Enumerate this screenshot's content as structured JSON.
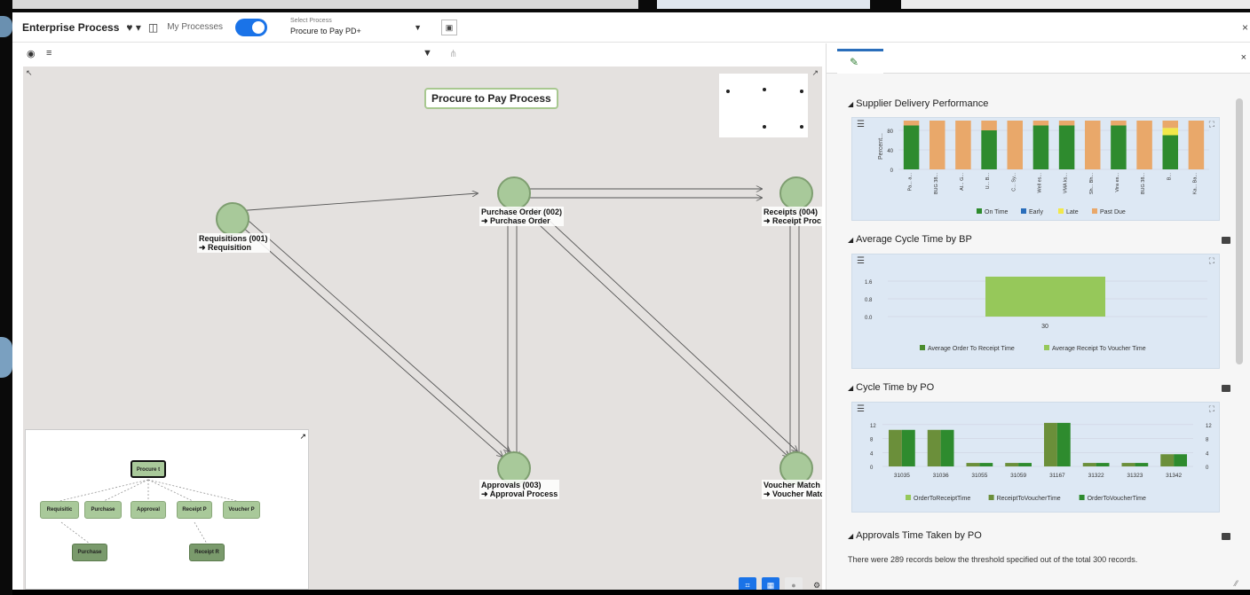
{
  "toolbar": {
    "app_title": "Enterprise Process",
    "my_processes_label": "My Processes",
    "select_process_label": "Select Process",
    "select_process_value": "Procure to Pay PD+"
  },
  "diagram": {
    "title": "Procure to Pay Process",
    "nodes": [
      {
        "id": "requisitions",
        "line1": "Requisitions (001)",
        "line2": "➜ Requisition"
      },
      {
        "id": "purchase_order",
        "line1": "Purchase Order (002)",
        "line2": "➜ Purchase Order"
      },
      {
        "id": "receipts",
        "line1": "Receipts (004)",
        "line2": "➜ Receipt Proc"
      },
      {
        "id": "approvals",
        "line1": "Approvals (003)",
        "line2": "➜ Approval Process"
      },
      {
        "id": "voucher_match",
        "line1": "Voucher Match (",
        "line2": "➜ Voucher Matc"
      }
    ]
  },
  "minimap": {
    "root": "Procure t",
    "children": [
      "Requisitic",
      "Purchase",
      "Approval",
      "Receipt P",
      "Voucher P"
    ],
    "grandchildren": [
      "Purchase",
      "Receipt R"
    ]
  },
  "panel": {
    "sections": [
      {
        "title": "Supplier Delivery Performance"
      },
      {
        "title": "Average Cycle Time by BP"
      },
      {
        "title": "Cycle Time by PO"
      },
      {
        "title": "Approvals Time Taken by PO"
      }
    ],
    "approvals_note": "There were 289 records below the threshold specified out of the total 300 records."
  },
  "colors": {
    "on_time": "#2e8b2e",
    "early": "#2a6ebb",
    "late": "#f2e84a",
    "past_due": "#e9a86a",
    "avg_order_to_receipt": "#4b8c2e",
    "avg_receipt_to_voucher": "#96c85a",
    "accent": "#1a73e8"
  },
  "chart_data": [
    {
      "type": "bar",
      "title": "Supplier Delivery Performance",
      "ylabel": "Percent...",
      "ylim": [
        0,
        100
      ],
      "yticks": [
        0,
        40,
        80
      ],
      "categories": [
        "Pa... a...",
        "BUG 38...",
        "Al... G...",
        "U... B...",
        "C... Sy...",
        "Well es...",
        "VMA ks...",
        "Sh... Bh...",
        "Vira es...",
        "BUG 38...",
        "B...",
        "Ka... Ba..."
      ],
      "series": [
        {
          "name": "On Time",
          "values": [
            90,
            0,
            0,
            80,
            0,
            90,
            90,
            0,
            90,
            0,
            70,
            0
          ]
        },
        {
          "name": "Early",
          "values": [
            0,
            0,
            0,
            0,
            0,
            0,
            0,
            0,
            0,
            0,
            0,
            0
          ]
        },
        {
          "name": "Late",
          "values": [
            0,
            0,
            0,
            0,
            0,
            0,
            0,
            0,
            0,
            0,
            15,
            0
          ]
        },
        {
          "name": "Past Due",
          "values": [
            10,
            100,
            100,
            20,
            100,
            10,
            10,
            100,
            10,
            100,
            15,
            100
          ]
        }
      ],
      "stacked": true,
      "legend": "bottom"
    },
    {
      "type": "bar",
      "title": "Average Cycle Time by BP",
      "ylim": [
        0,
        2
      ],
      "yticks": [
        "1.6",
        "0.8",
        "0.0"
      ],
      "categories": [
        "30"
      ],
      "series": [
        {
          "name": "Average Order To Receipt Time",
          "values": [
            0
          ]
        },
        {
          "name": "Average Receipt To Voucher Time",
          "values": [
            1.8
          ]
        }
      ],
      "legend": "bottom"
    },
    {
      "type": "bar",
      "title": "Cycle Time by PO",
      "ylim": [
        0,
        14
      ],
      "yticks": [
        0,
        4,
        8,
        12
      ],
      "categories": [
        "31035",
        "31036",
        "31055",
        "31059",
        "31167",
        "31322",
        "31323",
        "31342"
      ],
      "series": [
        {
          "name": "OrderToReceiptTime",
          "values": [
            0,
            0,
            0,
            0,
            0,
            0,
            0,
            0
          ]
        },
        {
          "name": "ReceiptToVoucherTime",
          "values": [
            10.5,
            10.5,
            1,
            1,
            12.5,
            1,
            1,
            3.5
          ]
        },
        {
          "name": "OrderToVoucherTime",
          "values": [
            10.5,
            10.5,
            1,
            1,
            12.5,
            1,
            1,
            3.5
          ]
        }
      ],
      "legend": "bottom"
    }
  ]
}
